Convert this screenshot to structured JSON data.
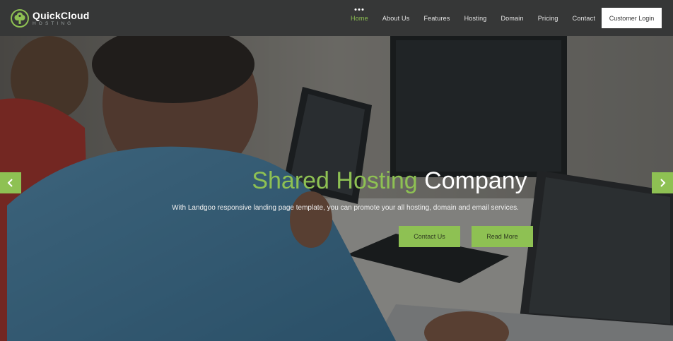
{
  "brand": {
    "name": "QuickCloud",
    "tagline": "HOSTING",
    "accent_color": "#8ec153",
    "nav_bg": "#363737"
  },
  "nav": {
    "items": [
      {
        "label": "Home",
        "active": true
      },
      {
        "label": "About Us",
        "active": false
      },
      {
        "label": "Features",
        "active": false
      },
      {
        "label": "Hosting",
        "active": false
      },
      {
        "label": "Domain",
        "active": false
      },
      {
        "label": "Pricing",
        "active": false
      },
      {
        "label": "Contact",
        "active": false
      }
    ],
    "login_label": "Customer Login"
  },
  "hero": {
    "title_accent": "Shared Hosting",
    "title_rest": "Company",
    "subtitle": "With Landgoo responsive landing page template, you can promote your all hosting, domain and email services.",
    "buttons": {
      "contact": "Contact Us",
      "read_more": "Read More"
    },
    "arrows": {
      "prev_icon": "chevron-left-icon",
      "next_icon": "chevron-right-icon"
    }
  }
}
